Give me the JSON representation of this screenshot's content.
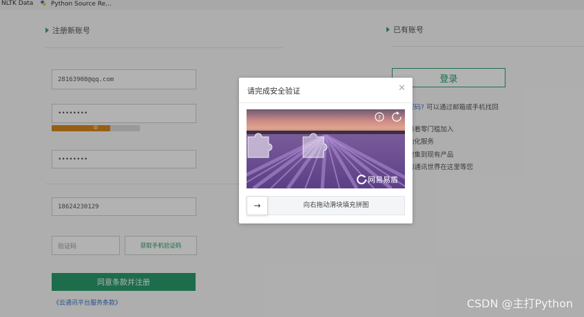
{
  "bookmarks": [
    {
      "label": "NLTK Data",
      "icon": "bookmark-icon"
    },
    {
      "label": "Python Source Re...",
      "icon": "python-icon"
    }
  ],
  "register": {
    "title": "注册新账号",
    "email_value": "28163908@qq.com",
    "password_value": "••••••••",
    "strength_label": "中",
    "confirm_value": "••••••••",
    "phone_value": "18624230129",
    "code_placeholder": "验证码",
    "get_code_label": "获取手机验证码",
    "submit_label": "同意条款并注册",
    "terms_label": "《云通讯平台服务条款》"
  },
  "account": {
    "title": "已有账号",
    "login_label": "登录",
    "forgot_link": "密码?",
    "forgot_text": "可以通过邮箱或手机找回",
    "line1": "接着零门槛加入",
    "line2": "动化服务",
    "line3": "速集到现有产品",
    "line4": "的通讯世界在这里等您"
  },
  "captcha": {
    "title": "请完成安全验证",
    "close_icon": "close-icon",
    "help_icon": "help-icon",
    "refresh_icon": "refresh-icon",
    "brand": "网易易盾",
    "slider_text": "向右拖动滑块填充拼图",
    "slider_arrow": "→"
  },
  "watermark": "CSDN @主打Python",
  "colors": {
    "accent": "#2a9d6d",
    "strength_mid": "#d98a1e"
  }
}
